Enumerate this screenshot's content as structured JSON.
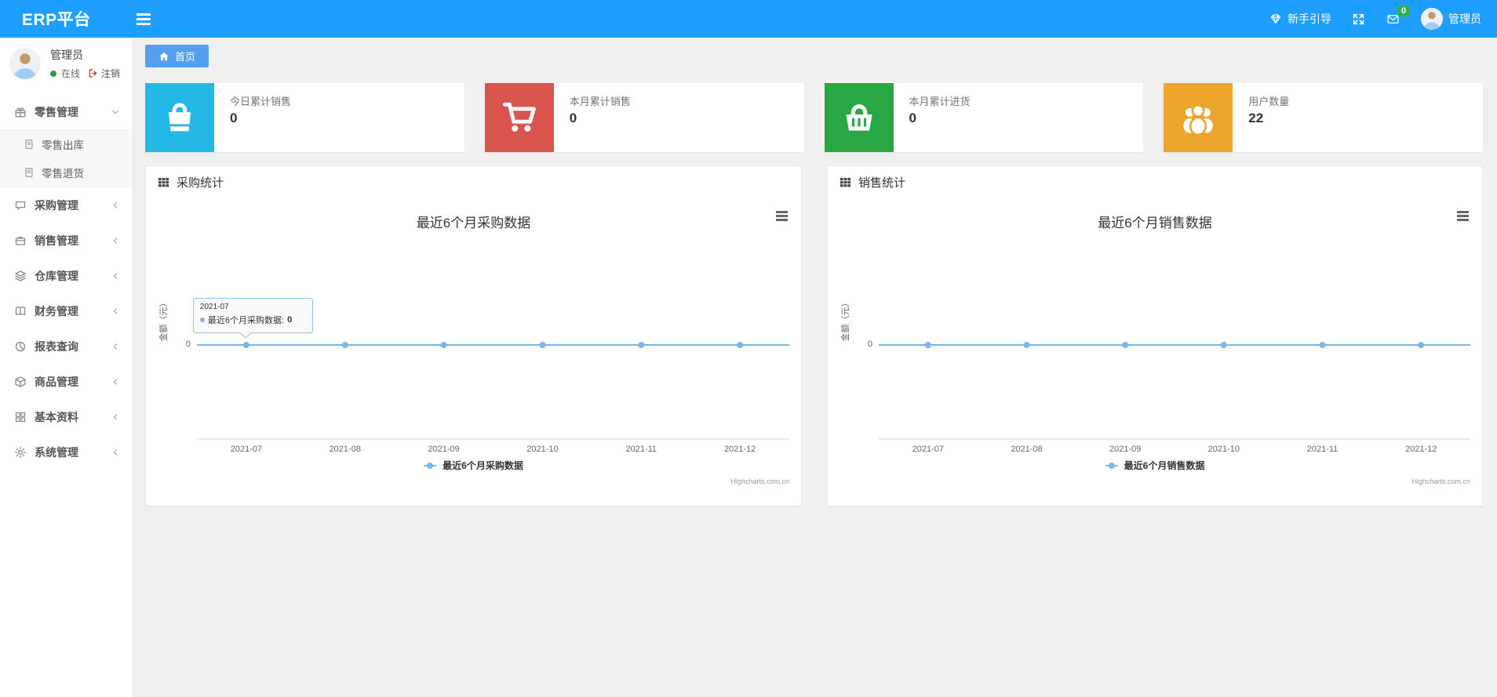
{
  "navbar": {
    "brand": "ERP平台",
    "guide_label": "新手引导",
    "mail_badge": "0",
    "user_name": "管理员",
    "bg_color": "#1E9FFF"
  },
  "sidebar": {
    "user": {
      "name": "管理员",
      "status": "在线",
      "logout": "注销"
    },
    "menu": [
      {
        "label": "零售管理",
        "icon": "gift-icon",
        "state": "expanded",
        "children": [
          {
            "label": "零售出库",
            "icon": "file-icon"
          },
          {
            "label": "零售退货",
            "icon": "file-icon"
          }
        ]
      },
      {
        "label": "采购管理",
        "icon": "comment-icon",
        "state": "collapsed",
        "children": []
      },
      {
        "label": "销售管理",
        "icon": "briefcase-icon",
        "state": "collapsed",
        "children": []
      },
      {
        "label": "仓库管理",
        "icon": "layers-icon",
        "state": "collapsed",
        "children": []
      },
      {
        "label": "财务管理",
        "icon": "book-icon",
        "state": "collapsed",
        "children": []
      },
      {
        "label": "报表查询",
        "icon": "pie-chart-icon",
        "state": "collapsed",
        "children": []
      },
      {
        "label": "商品管理",
        "icon": "box-icon",
        "state": "collapsed",
        "children": []
      },
      {
        "label": "基本资料",
        "icon": "grid-icon",
        "state": "collapsed",
        "children": []
      },
      {
        "label": "系统管理",
        "icon": "gear-icon",
        "state": "collapsed",
        "children": []
      }
    ]
  },
  "tabs": [
    {
      "label": "首页",
      "active": true
    }
  ],
  "stat_cards": [
    {
      "label": "今日累计销售",
      "value": "0",
      "color": "#23b7e5",
      "icon": "shopping-bag-icon"
    },
    {
      "label": "本月累计销售",
      "value": "0",
      "color": "#d9534f",
      "icon": "cart-icon"
    },
    {
      "label": "本月累计进货",
      "value": "0",
      "color": "#28a745",
      "icon": "basket-icon"
    },
    {
      "label": "用户数量",
      "value": "22",
      "color": "#eda52d",
      "icon": "users-icon"
    }
  ],
  "panels": [
    {
      "header": "采购统计"
    },
    {
      "header": "销售统计"
    }
  ],
  "chart_data": [
    {
      "type": "line",
      "title": "最近6个月采购数据",
      "categories": [
        "2021-07",
        "2021-08",
        "2021-09",
        "2021-10",
        "2021-11",
        "2021-12"
      ],
      "series": [
        {
          "name": "最近6个月采购数据",
          "values": [
            0,
            0,
            0,
            0,
            0,
            0
          ]
        }
      ],
      "xlabel": "",
      "ylabel": "金额（元）",
      "yticks": [
        "0"
      ],
      "ylim": [
        -1,
        1
      ],
      "grid": false,
      "legend_position": "bottom",
      "line_color": "#7cb5ec",
      "credits": "Highcharts.com.cn",
      "tooltip": {
        "header": "2021-07",
        "label": "最近6个月采购数据",
        "value": "0",
        "point_index": 0
      }
    },
    {
      "type": "line",
      "title": "最近6个月销售数据",
      "categories": [
        "2021-07",
        "2021-08",
        "2021-09",
        "2021-10",
        "2021-11",
        "2021-12"
      ],
      "series": [
        {
          "name": "最近6个月销售数据",
          "values": [
            0,
            0,
            0,
            0,
            0,
            0
          ]
        }
      ],
      "xlabel": "",
      "ylabel": "金额（元）",
      "yticks": [
        "0"
      ],
      "ylim": [
        -1,
        1
      ],
      "grid": false,
      "legend_position": "bottom",
      "line_color": "#7cb5ec",
      "credits": "Highcharts.com.cn",
      "tooltip": null
    }
  ]
}
